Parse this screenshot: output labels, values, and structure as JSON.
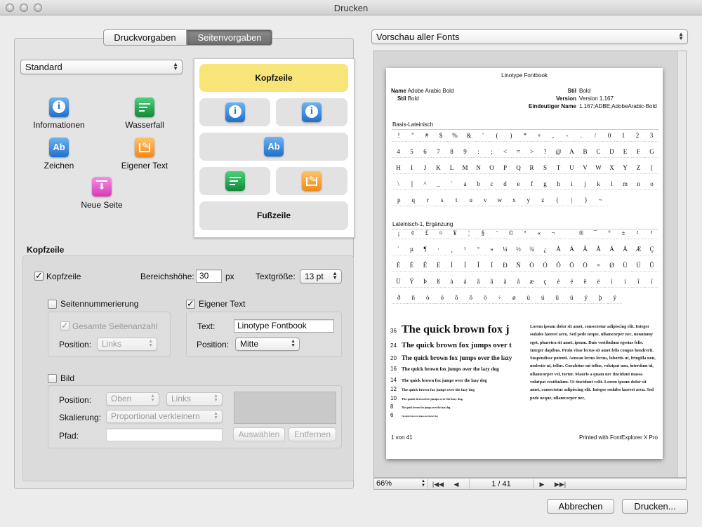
{
  "window": {
    "title": "Drucken"
  },
  "tabs": [
    {
      "label": "Druckvorgaben"
    },
    {
      "label": "Seitenvorgaben"
    }
  ],
  "preset": {
    "value": "Standard"
  },
  "palette": [
    {
      "label": "Informationen",
      "icon": "info-icon"
    },
    {
      "label": "Wasserfall",
      "icon": "waterfall-icon"
    },
    {
      "label": "Zeichen",
      "icon": "characters-icon"
    },
    {
      "label": "Eigener Text",
      "icon": "custom-text-icon"
    },
    {
      "label": "Neue Seite",
      "icon": "new-page-icon"
    }
  ],
  "layout": {
    "header": "Kopfzeile",
    "footer": "Fußzeile"
  },
  "kopfzeile": {
    "section_title": "Kopfzeile",
    "enabled_label": "Kopfzeile",
    "height_label": "Bereichshöhe:",
    "height_value": "30",
    "height_unit": "px",
    "size_label": "Textgröße:",
    "size_value": "13 pt",
    "numbering": {
      "label": "Seitennummerierung",
      "total_label": "Gesamte Seitenanzahl",
      "position_label": "Position:",
      "position_value": "Links"
    },
    "custom_text": {
      "label": "Eigener Text",
      "text_label": "Text:",
      "text_value": "Linotype Fontbook",
      "position_label": "Position:",
      "position_value": "Mitte"
    },
    "image": {
      "label": "Bild",
      "position_label": "Position:",
      "position_v": "Oben",
      "position_h": "Links",
      "scale_label": "Skalierung:",
      "scale_value": "Proportional verkleinern",
      "path_label": "Pfad:",
      "path_value": "",
      "choose": "Auswählen",
      "remove": "Entfernen"
    }
  },
  "preview_select": {
    "value": "Vorschau aller Fonts"
  },
  "page": {
    "header": "Linotype Fontbook",
    "name_label": "Name",
    "name_value": "Adobe Arabic Bold",
    "stil_label": "Stil",
    "stil_value": "Bold",
    "stil2_label": "Stil",
    "stil2_value": "Bold",
    "version_label": "Version",
    "version_value": "Version 1.167",
    "unique_label": "Eindeutiger Name",
    "unique_value": "1.167;ADBE;AdobeArabic-Bold",
    "section1": "Basis-Lateinisch",
    "section2": "Lateinisch-1, Ergänzung",
    "rows1": [
      "! \" # $ % & ' ( ) * + , - . / 0 1 2 3",
      "4 5 6 7 8 9 : ; < = > ? @ A B C D E F G",
      "H I J K L M N O P Q R S T U V W X Y Z [",
      "\\ ] ^ _ ` a b c d e f g h i j k l m n o",
      "p q r s t u v w x y z { | } ~"
    ],
    "rows2": [
      "¡ ¢ £ ¤ ¥ ¦ § ¨ © ª « ¬ ­ ® ¯ ° ± ² ³",
      "´ µ ¶ · ¸ ¹ º » ¼ ½ ¾ ¿ À Á Â Ã Ä Å Æ Ç",
      "È É Ê Ë Ì Í Î Ï Ð Ñ Ò Ó Ô Õ Ö × Ø Ù Ú Û",
      "Ü Ý Þ ß à á â ã ä å æ ç è é ê ë ì í î ï",
      "ð ñ ò ó ô õ ö ÷ ø ù ú û ü ý þ ÿ"
    ],
    "waterfall": [
      {
        "size": "36",
        "text": "The quick brown fox j"
      },
      {
        "size": "24",
        "text": "The quick brown fox jumps over t"
      },
      {
        "size": "20",
        "text": "The quick brown fox jumps over the lazy"
      },
      {
        "size": "16",
        "text": "The quick brown fox jumps over the lazy dog"
      },
      {
        "size": "14",
        "text": "The quick brown fox jumps over the lazy dog"
      },
      {
        "size": "12",
        "text": "The quick brown fox jumps over the lazy dog"
      },
      {
        "size": "10",
        "text": "The quick brown fox jumps over the lazy dog"
      },
      {
        "size": "8",
        "text": "The quick brown fox jumps over the lazy dog"
      },
      {
        "size": "6",
        "text": "The quick brown fox jumps over the lazy dog"
      }
    ],
    "lorem": "Lorem ipsum dolor sit amet, consectetur adipiscing elit. Integer sodales laoreet arcu. Sed pede neque, ullamcorper nec, nonummy eget, pharetra sit amet, ipsum. Duis vestibulum egestas felis. Integer dapibus. Proin vitae lectus sit amet felis congue hendrerit. Suspendisse potenti. Aenean lectus lectus, lobortis ut, fringilla non, molestie ut, tellus. Curabitur mi tellus, volutpat non, interdum id, ullamcorper vel, tortor. Mauris a quam nec tincidunt massa volutpat vestibulum. Ut tincidunt velit. Lorem ipsum dolor sit amet, consectetur adipiscing elit. Integer sodales laoreet arcu. Sed pede neque, ullamcorper nec,",
    "footer_left": "1 von 41",
    "footer_right": "Printed with FontExplorer X Pro"
  },
  "pager": {
    "zoom": "66%",
    "page": "1 / 41"
  },
  "buttons": {
    "cancel": "Abbrechen",
    "print": "Drucken..."
  }
}
